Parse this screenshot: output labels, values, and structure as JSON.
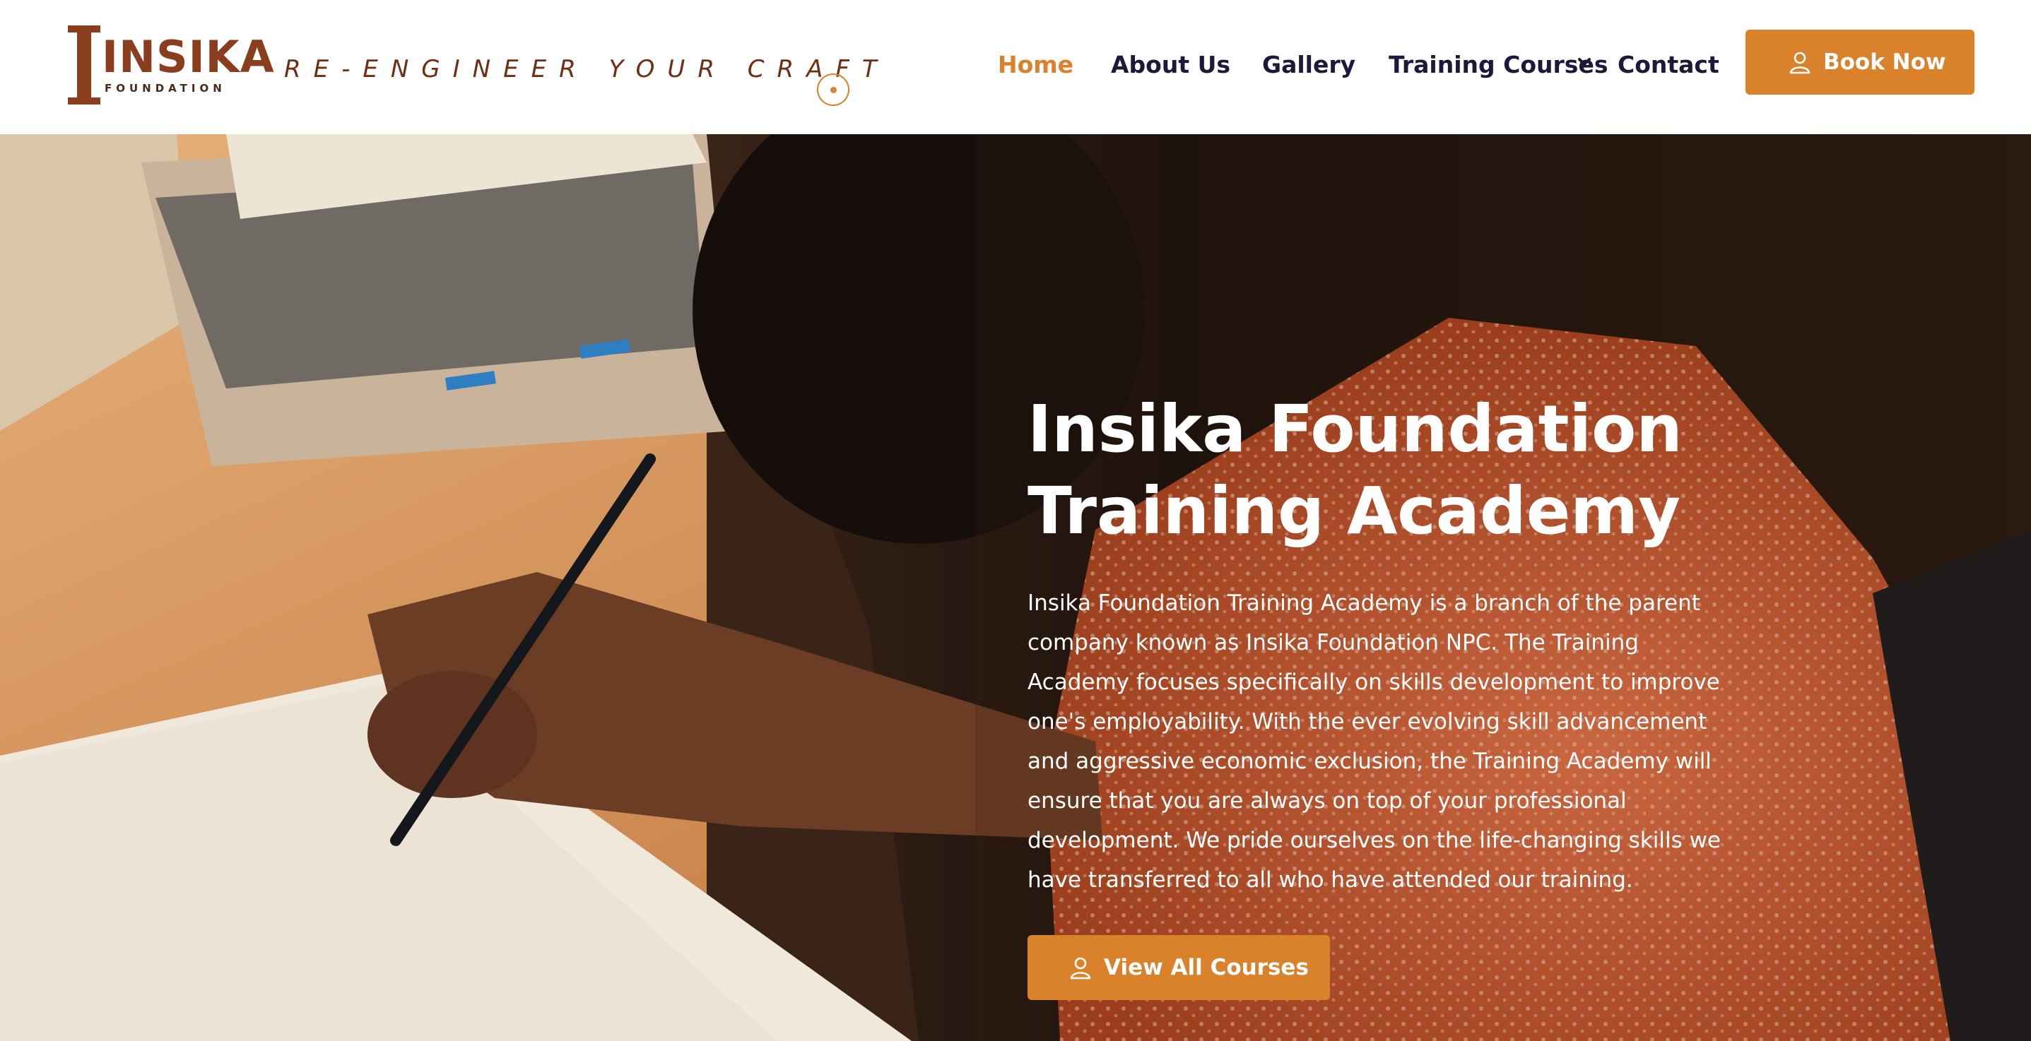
{
  "brand": {
    "logo_word": "INSIKA",
    "logo_sub": "FOUNDATION",
    "tagline": "RE-ENGINEER YOUR CRAFT"
  },
  "nav": {
    "home": "Home",
    "about": "About Us",
    "gallery": "Gallery",
    "training": "Training Courses",
    "contact": "Contact",
    "active": "Home"
  },
  "cta": {
    "book_now": "Book Now",
    "view_courses": "View All Courses"
  },
  "hero": {
    "title_line1": "Insika Foundation",
    "title_line2": "Training Academy",
    "text": "Insika Foundation Training Academy is a branch of the parent company known as Insika Foundation NPC. The Training Academy focuses specifically on skills development to improve one's employability. With the ever evolving skill advancement and aggressive economic exclusion, the Training Academy will ensure that you are always on top of your professional development. We pride ourselves on the life-changing skills we have transferred to all who have attended our training."
  },
  "icons": {
    "book_now": "user-icon",
    "view_courses": "user-icon",
    "training_dropdown": "chevron-down-icon",
    "scroll_indicator": "ring-dot-icon"
  },
  "colors": {
    "accent": "#d9822b",
    "brand": "#8a3e1d",
    "nav_text": "#1b1a3c",
    "tagline": "#6e2f14"
  }
}
